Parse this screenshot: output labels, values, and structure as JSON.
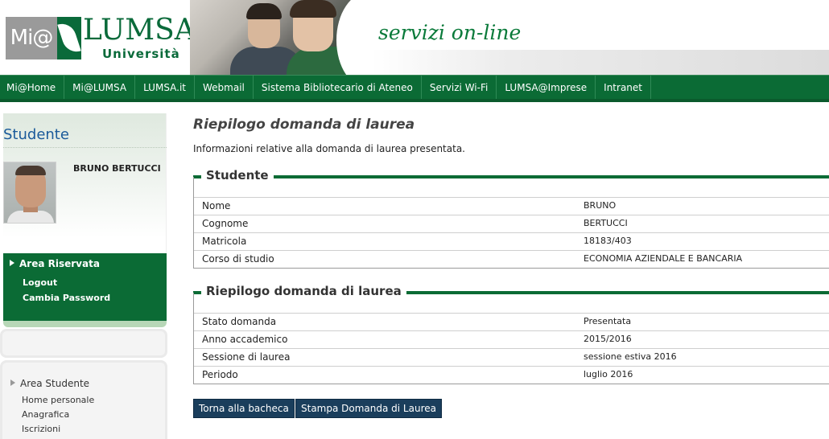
{
  "header": {
    "logo_mi": "Mi@",
    "logo_lumsa": "LUMSA",
    "logo_univ": "Università",
    "tagline": "servizi on-line"
  },
  "nav": {
    "items": [
      "Mi@Home",
      "Mi@LUMSA",
      "LUMSA.it",
      "Webmail",
      "Sistema Bibliotecario di Ateneo",
      "Servizi Wi-Fi",
      "LUMSA@Imprese",
      "Intranet"
    ]
  },
  "sidebar": {
    "title": "Studente",
    "student_name": "BRUNO BERTUCCI",
    "area_riservata": {
      "title": "Area Riservata",
      "links": [
        "Logout",
        "Cambia Password"
      ]
    },
    "area_studente": {
      "title": "Area Studente",
      "links": [
        "Home personale",
        "Anagrafica",
        "Iscrizioni"
      ]
    }
  },
  "main": {
    "title": "Riepilogo domanda di laurea",
    "description": "Informazioni relative alla domanda di laurea presentata.",
    "student_section": {
      "legend": "Studente",
      "rows": [
        {
          "label": "Nome",
          "value": "BRUNO"
        },
        {
          "label": "Cognome",
          "value": "BERTUCCI"
        },
        {
          "label": "Matricola",
          "value": "18183/403"
        },
        {
          "label": "Corso di studio",
          "value": "ECONOMIA AZIENDALE E BANCARIA"
        }
      ]
    },
    "riepilogo_section": {
      "legend": "Riepilogo domanda di laurea",
      "rows": [
        {
          "label": "Stato domanda",
          "value": "Presentata"
        },
        {
          "label": "Anno accademico",
          "value": "2015/2016"
        },
        {
          "label": "Sessione di laurea",
          "value": "sessione estiva 2016"
        },
        {
          "label": "Periodo",
          "value": "luglio 2016"
        }
      ]
    },
    "buttons": {
      "back": "Torna alla bacheca",
      "print": "Stampa Domanda di Laurea"
    }
  },
  "colors": {
    "brand_green": "#0b6b35",
    "title_blue": "#1a5a9a",
    "button_navy": "#1a3e5c"
  }
}
